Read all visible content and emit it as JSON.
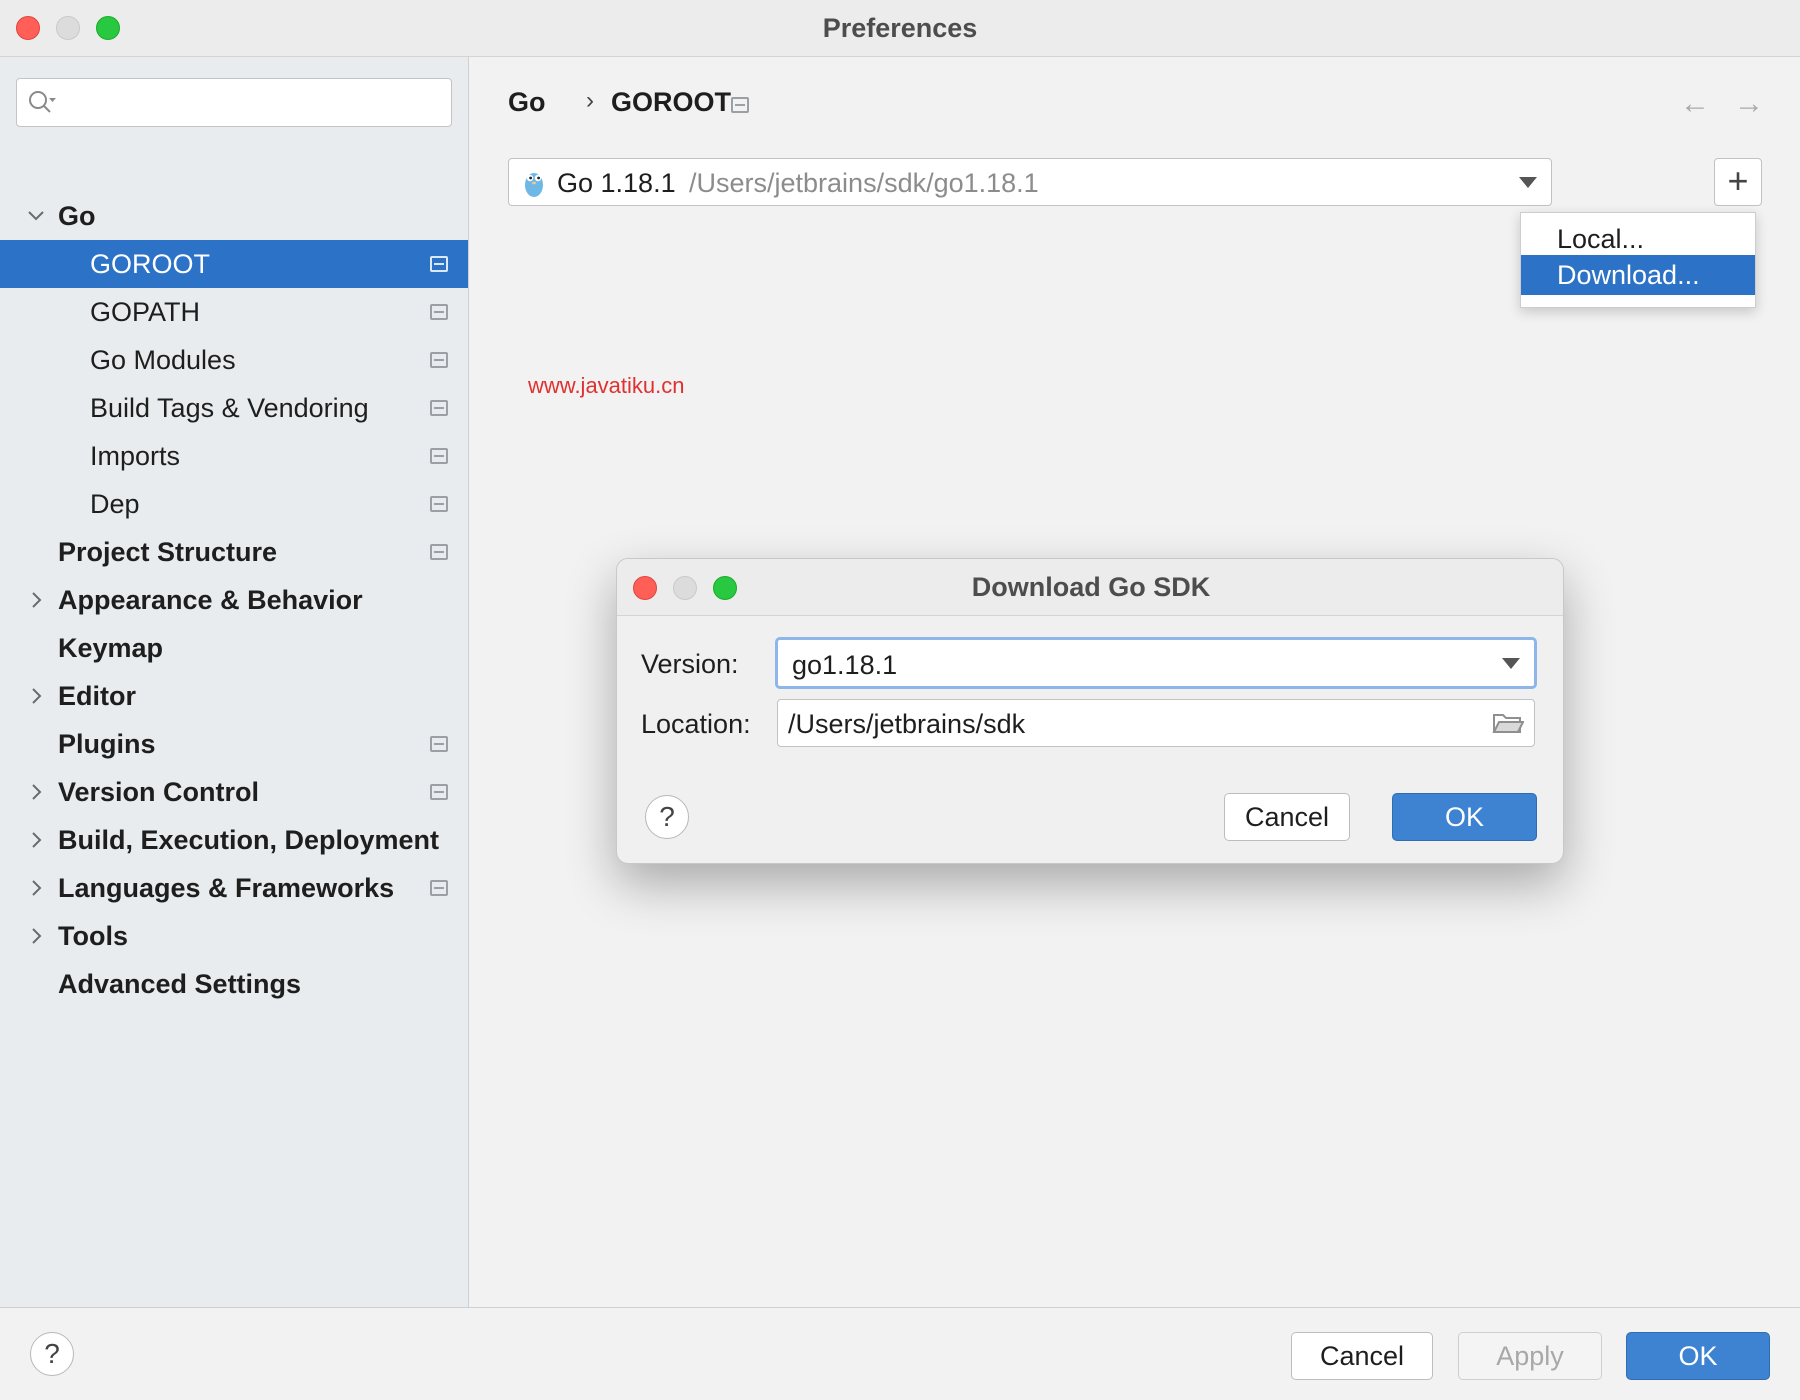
{
  "window": {
    "title": "Preferences"
  },
  "search": {
    "placeholder": "",
    "value": ""
  },
  "sidebar": {
    "items": [
      {
        "label": "Go",
        "bold": true,
        "level": 1,
        "expander": "expanded",
        "project_icon": false,
        "selected": false
      },
      {
        "label": "GOROOT",
        "bold": false,
        "level": 2,
        "expander": "none",
        "project_icon": true,
        "selected": true
      },
      {
        "label": "GOPATH",
        "bold": false,
        "level": 2,
        "expander": "none",
        "project_icon": true,
        "selected": false
      },
      {
        "label": "Go Modules",
        "bold": false,
        "level": 2,
        "expander": "none",
        "project_icon": true,
        "selected": false
      },
      {
        "label": "Build Tags & Vendoring",
        "bold": false,
        "level": 2,
        "expander": "none",
        "project_icon": true,
        "selected": false
      },
      {
        "label": "Imports",
        "bold": false,
        "level": 2,
        "expander": "none",
        "project_icon": true,
        "selected": false
      },
      {
        "label": "Dep",
        "bold": false,
        "level": 2,
        "expander": "none",
        "project_icon": true,
        "selected": false
      },
      {
        "label": "Project Structure",
        "bold": true,
        "level": 1,
        "expander": "none",
        "project_icon": true,
        "selected": false
      },
      {
        "label": "Appearance & Behavior",
        "bold": true,
        "level": 1,
        "expander": "collapsed",
        "project_icon": false,
        "selected": false
      },
      {
        "label": "Keymap",
        "bold": true,
        "level": 1,
        "expander": "none",
        "project_icon": false,
        "selected": false
      },
      {
        "label": "Editor",
        "bold": true,
        "level": 1,
        "expander": "collapsed",
        "project_icon": false,
        "selected": false
      },
      {
        "label": "Plugins",
        "bold": true,
        "level": 1,
        "expander": "none",
        "project_icon": true,
        "selected": false
      },
      {
        "label": "Version Control",
        "bold": true,
        "level": 1,
        "expander": "collapsed",
        "project_icon": true,
        "selected": false
      },
      {
        "label": "Build, Execution, Deployment",
        "bold": true,
        "level": 1,
        "expander": "collapsed",
        "project_icon": false,
        "selected": false
      },
      {
        "label": "Languages & Frameworks",
        "bold": true,
        "level": 1,
        "expander": "collapsed",
        "project_icon": true,
        "selected": false
      },
      {
        "label": "Tools",
        "bold": true,
        "level": 1,
        "expander": "collapsed",
        "project_icon": false,
        "selected": false
      },
      {
        "label": "Advanced Settings",
        "bold": true,
        "level": 1,
        "expander": "none",
        "project_icon": false,
        "selected": false
      }
    ]
  },
  "breadcrumb": {
    "parent": "Go",
    "separator": "›",
    "current": "GOROOT"
  },
  "nav": {
    "back_icon": "arrow-left-icon",
    "forward_icon": "arrow-right-icon"
  },
  "sdk": {
    "name": "Go 1.18.1",
    "path": "/Users/jetbrains/sdk/go1.18.1",
    "icon": "gopher-icon"
  },
  "add_button": {
    "label": "+"
  },
  "add_menu": {
    "items": [
      "Local...",
      "Download..."
    ],
    "highlighted": "Download..."
  },
  "watermark": "www.javatiku.cn",
  "download_dialog": {
    "title": "Download Go SDK",
    "version_label": "Version:",
    "version_value": "go1.18.1",
    "location_label": "Location:",
    "location_value": "/Users/jetbrains/sdk",
    "help": "?",
    "cancel": "Cancel",
    "ok": "OK"
  },
  "footer": {
    "help": "?",
    "cancel": "Cancel",
    "apply": "Apply",
    "ok": "OK"
  },
  "colors": {
    "selection": "#2c72c7",
    "primary_button": "#3d83d2",
    "close": "#ff5f57",
    "maximize": "#28c840",
    "watermark": "#e03131"
  }
}
